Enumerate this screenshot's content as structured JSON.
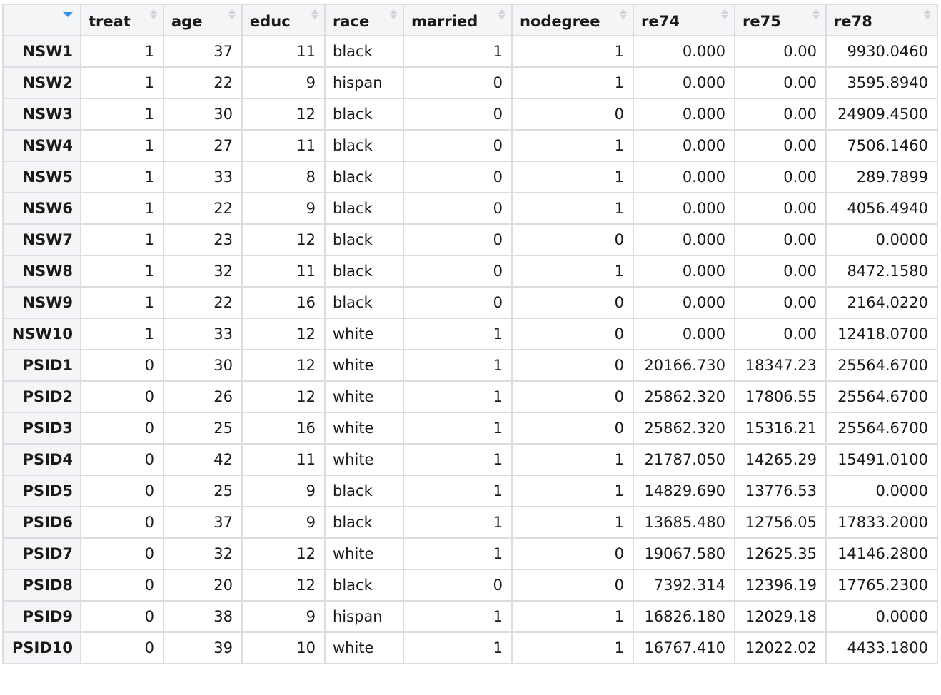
{
  "table": {
    "columns": [
      {
        "label": "treat"
      },
      {
        "label": "age"
      },
      {
        "label": "educ"
      },
      {
        "label": "race"
      },
      {
        "label": "married"
      },
      {
        "label": "nodegree"
      },
      {
        "label": "re74"
      },
      {
        "label": "re75"
      },
      {
        "label": "re78"
      }
    ],
    "sort_indicator_color": "#3b8fe0",
    "rows": [
      {
        "name": "NSW1",
        "cells": [
          "1",
          "37",
          "11",
          "black",
          "1",
          "1",
          "0.000",
          "0.00",
          "9930.0460"
        ]
      },
      {
        "name": "NSW2",
        "cells": [
          "1",
          "22",
          "9",
          "hispan",
          "0",
          "1",
          "0.000",
          "0.00",
          "3595.8940"
        ]
      },
      {
        "name": "NSW3",
        "cells": [
          "1",
          "30",
          "12",
          "black",
          "0",
          "0",
          "0.000",
          "0.00",
          "24909.4500"
        ]
      },
      {
        "name": "NSW4",
        "cells": [
          "1",
          "27",
          "11",
          "black",
          "0",
          "1",
          "0.000",
          "0.00",
          "7506.1460"
        ]
      },
      {
        "name": "NSW5",
        "cells": [
          "1",
          "33",
          "8",
          "black",
          "0",
          "1",
          "0.000",
          "0.00",
          "289.7899"
        ]
      },
      {
        "name": "NSW6",
        "cells": [
          "1",
          "22",
          "9",
          "black",
          "0",
          "1",
          "0.000",
          "0.00",
          "4056.4940"
        ]
      },
      {
        "name": "NSW7",
        "cells": [
          "1",
          "23",
          "12",
          "black",
          "0",
          "0",
          "0.000",
          "0.00",
          "0.0000"
        ]
      },
      {
        "name": "NSW8",
        "cells": [
          "1",
          "32",
          "11",
          "black",
          "0",
          "1",
          "0.000",
          "0.00",
          "8472.1580"
        ]
      },
      {
        "name": "NSW9",
        "cells": [
          "1",
          "22",
          "16",
          "black",
          "0",
          "0",
          "0.000",
          "0.00",
          "2164.0220"
        ]
      },
      {
        "name": "NSW10",
        "cells": [
          "1",
          "33",
          "12",
          "white",
          "1",
          "0",
          "0.000",
          "0.00",
          "12418.0700"
        ]
      },
      {
        "name": "PSID1",
        "cells": [
          "0",
          "30",
          "12",
          "white",
          "1",
          "0",
          "20166.730",
          "18347.23",
          "25564.6700"
        ]
      },
      {
        "name": "PSID2",
        "cells": [
          "0",
          "26",
          "12",
          "white",
          "1",
          "0",
          "25862.320",
          "17806.55",
          "25564.6700"
        ]
      },
      {
        "name": "PSID3",
        "cells": [
          "0",
          "25",
          "16",
          "white",
          "1",
          "0",
          "25862.320",
          "15316.21",
          "25564.6700"
        ]
      },
      {
        "name": "PSID4",
        "cells": [
          "0",
          "42",
          "11",
          "white",
          "1",
          "1",
          "21787.050",
          "14265.29",
          "15491.0100"
        ]
      },
      {
        "name": "PSID5",
        "cells": [
          "0",
          "25",
          "9",
          "black",
          "1",
          "1",
          "14829.690",
          "13776.53",
          "0.0000"
        ]
      },
      {
        "name": "PSID6",
        "cells": [
          "0",
          "37",
          "9",
          "black",
          "1",
          "1",
          "13685.480",
          "12756.05",
          "17833.2000"
        ]
      },
      {
        "name": "PSID7",
        "cells": [
          "0",
          "32",
          "12",
          "white",
          "1",
          "0",
          "19067.580",
          "12625.35",
          "14146.2800"
        ]
      },
      {
        "name": "PSID8",
        "cells": [
          "0",
          "20",
          "12",
          "black",
          "0",
          "0",
          "7392.314",
          "12396.19",
          "17765.2300"
        ]
      },
      {
        "name": "PSID9",
        "cells": [
          "0",
          "38",
          "9",
          "hispan",
          "1",
          "1",
          "16826.180",
          "12029.18",
          "0.0000"
        ]
      },
      {
        "name": "PSID10",
        "cells": [
          "0",
          "39",
          "10",
          "white",
          "1",
          "1",
          "16767.410",
          "12022.02",
          "4433.1800"
        ]
      }
    ]
  }
}
